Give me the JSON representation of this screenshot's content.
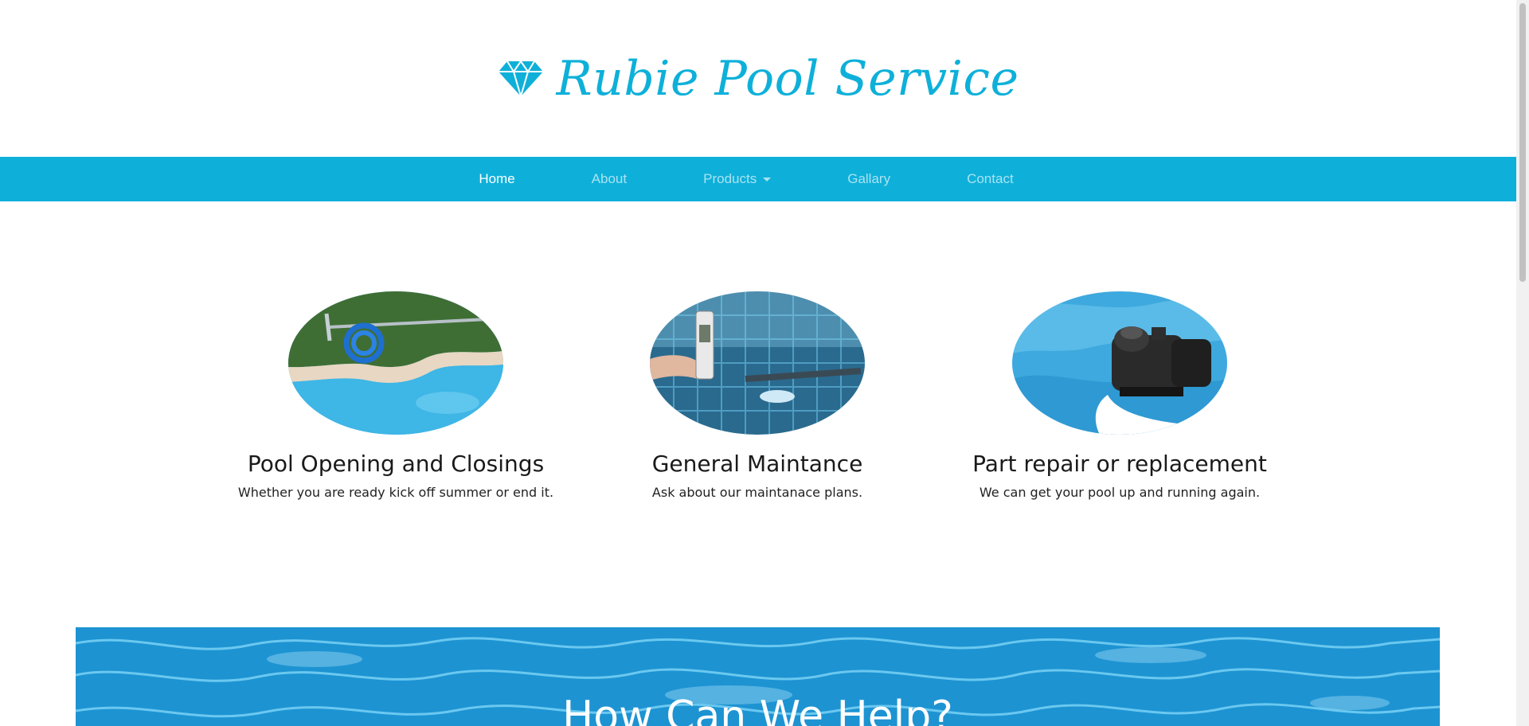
{
  "brand": {
    "title": "Rubie Pool Service",
    "icon": "diamond-icon",
    "color": "#0eb0d9"
  },
  "nav": {
    "background": "#0eb0d9",
    "items": [
      {
        "label": "Home",
        "active": true
      },
      {
        "label": "About",
        "active": false
      },
      {
        "label": "Products",
        "active": false,
        "dropdown": true
      },
      {
        "label": "Gallary",
        "active": false
      },
      {
        "label": "Contact",
        "active": false
      }
    ]
  },
  "services": [
    {
      "title": "Pool Opening and Closings",
      "description": "Whether you are ready kick off summer or end it."
    },
    {
      "title": "General Maintance",
      "description": "Ask about our maintanace plans."
    },
    {
      "title": "Part repair or replacement",
      "description": "We can get your pool up and running again."
    }
  ],
  "help": {
    "title": "How Can We Help?"
  }
}
